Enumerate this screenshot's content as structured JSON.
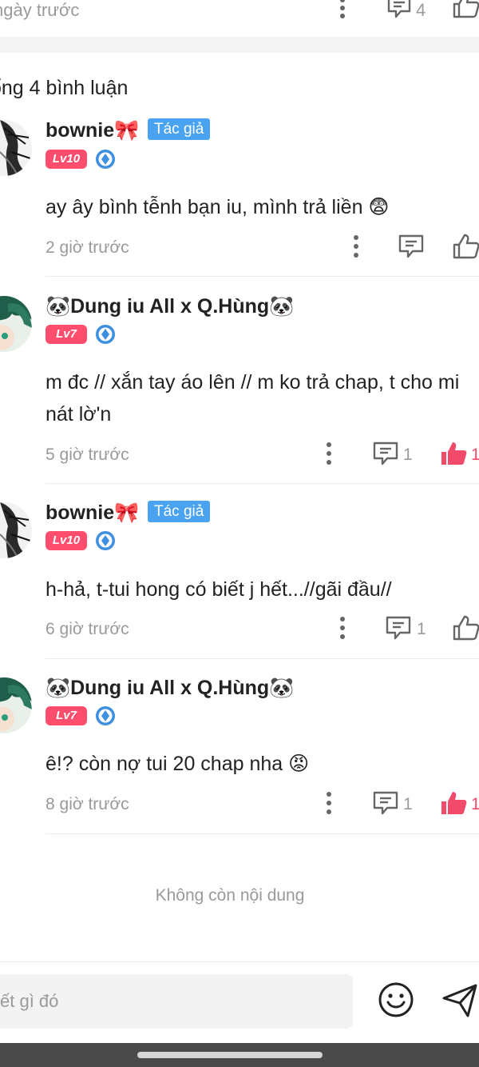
{
  "top_post": {
    "time": "ngày trước",
    "comment_count": "4"
  },
  "comments_header": {
    "total": "ổng 4 bình luận"
  },
  "comments": [
    {
      "name": "bownie🎀",
      "author_badge": "Tác giả",
      "level": "Lv10",
      "text": "ay ây bình tễnh bạn iu, mình trả liền 😨",
      "time": "2 giờ trước",
      "reply_count": "",
      "like_count": "",
      "liked": false
    },
    {
      "name": "🐼Dung iu All x Q.Hùng🐼",
      "author_badge": "",
      "level": "Lv7",
      "text": "m đc // xắn tay áo lên // m ko trả chap, t cho mi nát lờ'n",
      "time": "5 giờ trước",
      "reply_count": "1",
      "like_count": "1",
      "liked": true
    },
    {
      "name": "bownie🎀",
      "author_badge": "Tác giả",
      "level": "Lv10",
      "text": "h-hả, t-tui hong có biết j hết...//gãi đầu//",
      "time": "6 giờ trước",
      "reply_count": "1",
      "like_count": "",
      "liked": false
    },
    {
      "name": "🐼Dung iu All x Q.Hùng🐼",
      "author_badge": "",
      "level": "Lv7",
      "text": "ê!? còn nợ tui 20 chap nha 😡",
      "time": "8 giờ trước",
      "reply_count": "1",
      "like_count": "1",
      "liked": true
    }
  ],
  "footer": {
    "no_more": "Không còn nội dung"
  },
  "composer": {
    "placeholder": "ết gì đó"
  },
  "colors": {
    "accent_pink": "#ff4d6d",
    "author_badge_blue": "#4aa3f0",
    "muted_text": "#9a9a9a"
  }
}
